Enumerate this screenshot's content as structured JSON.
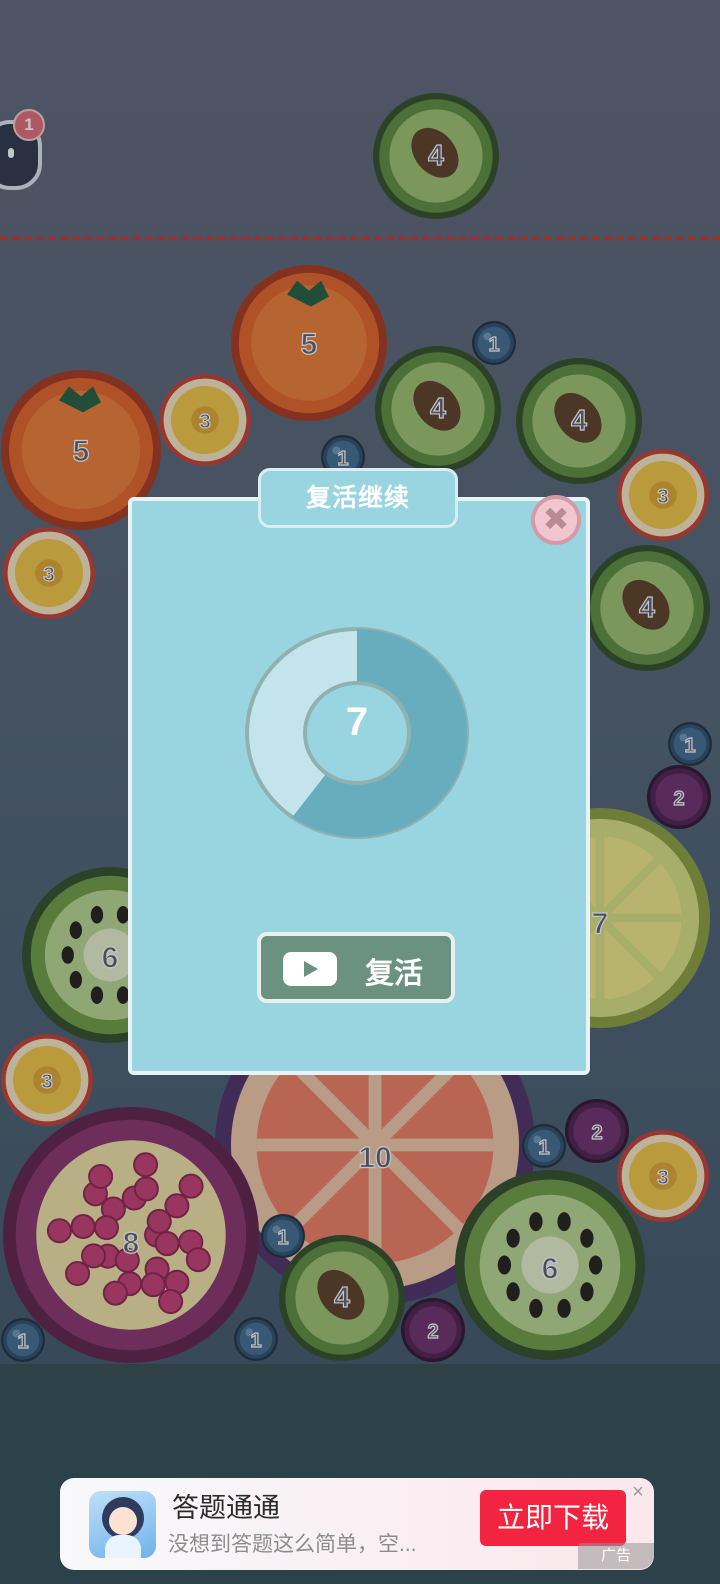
{
  "badge_count": "1",
  "modal": {
    "title": "复活继续",
    "countdown": "7",
    "countdown_progress": 0.6,
    "revive_label": "复活",
    "close_icon": "close-icon",
    "play_icon": "video-play-icon"
  },
  "ad": {
    "title": "答题通通",
    "subtitle": "没想到答题这么简单，空...",
    "cta": "立即下载",
    "tag": "广告"
  },
  "fruits": [
    {
      "level": "4",
      "kind": "avocado"
    },
    {
      "level": "5",
      "kind": "orange"
    },
    {
      "level": "1",
      "kind": "blueberry"
    },
    {
      "level": "5",
      "kind": "orange"
    },
    {
      "level": "3",
      "kind": "passionfruit"
    },
    {
      "level": "4",
      "kind": "avocado"
    },
    {
      "level": "4",
      "kind": "avocado"
    },
    {
      "level": "1",
      "kind": "blueberry"
    },
    {
      "level": "3",
      "kind": "passionfruit"
    },
    {
      "level": "3",
      "kind": "passionfruit"
    },
    {
      "level": "4",
      "kind": "avocado"
    },
    {
      "level": "1",
      "kind": "blueberry"
    },
    {
      "level": "2",
      "kind": "plum"
    },
    {
      "level": "7",
      "kind": "lemon"
    },
    {
      "level": "6",
      "kind": "kiwi"
    },
    {
      "level": "3",
      "kind": "passionfruit"
    },
    {
      "level": "10",
      "kind": "grapefruit"
    },
    {
      "level": "1",
      "kind": "blueberry"
    },
    {
      "level": "2",
      "kind": "plum"
    },
    {
      "level": "3",
      "kind": "passionfruit"
    },
    {
      "level": "8",
      "kind": "pomegranate"
    },
    {
      "level": "1",
      "kind": "blueberry"
    },
    {
      "level": "6",
      "kind": "kiwi"
    },
    {
      "level": "4",
      "kind": "avocado"
    },
    {
      "level": "2",
      "kind": "plum"
    },
    {
      "level": "1",
      "kind": "blueberry"
    },
    {
      "level": "1",
      "kind": "blueberry"
    }
  ]
}
